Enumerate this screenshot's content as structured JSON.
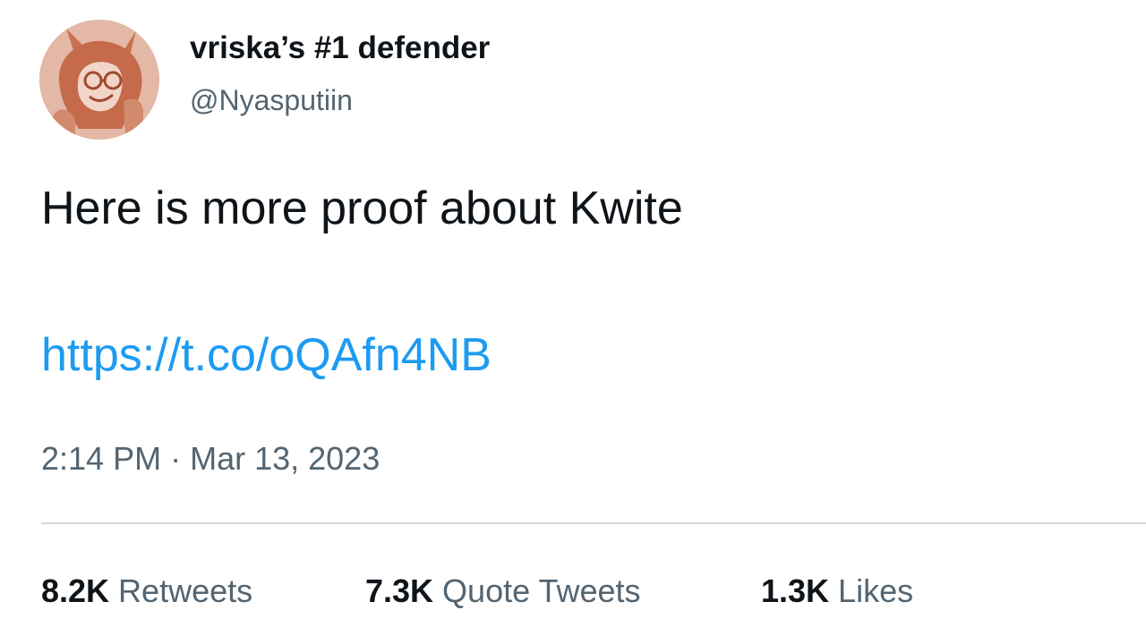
{
  "tweet": {
    "author": {
      "display_name": "vriska’s #1 defender",
      "handle": "@Nyasputiin",
      "avatar_icon": "user-avatar-illustration"
    },
    "text": "Here is more proof about Kwite",
    "link": "https://t.co/oQAfn4NB",
    "time": "2:14 PM",
    "separator": "·",
    "date": "Mar 13, 2023",
    "stats": {
      "retweets": {
        "count": "8.2K",
        "label": "Retweets"
      },
      "quote_tweets": {
        "count": "7.3K",
        "label": "Quote Tweets"
      },
      "likes": {
        "count": "1.3K",
        "label": "Likes"
      }
    }
  },
  "colors": {
    "text_primary": "#0f1419",
    "text_secondary": "#536471",
    "link": "#1d9bf0",
    "divider": "#d4d9dd",
    "avatar_bg": "#e3b8a6"
  }
}
